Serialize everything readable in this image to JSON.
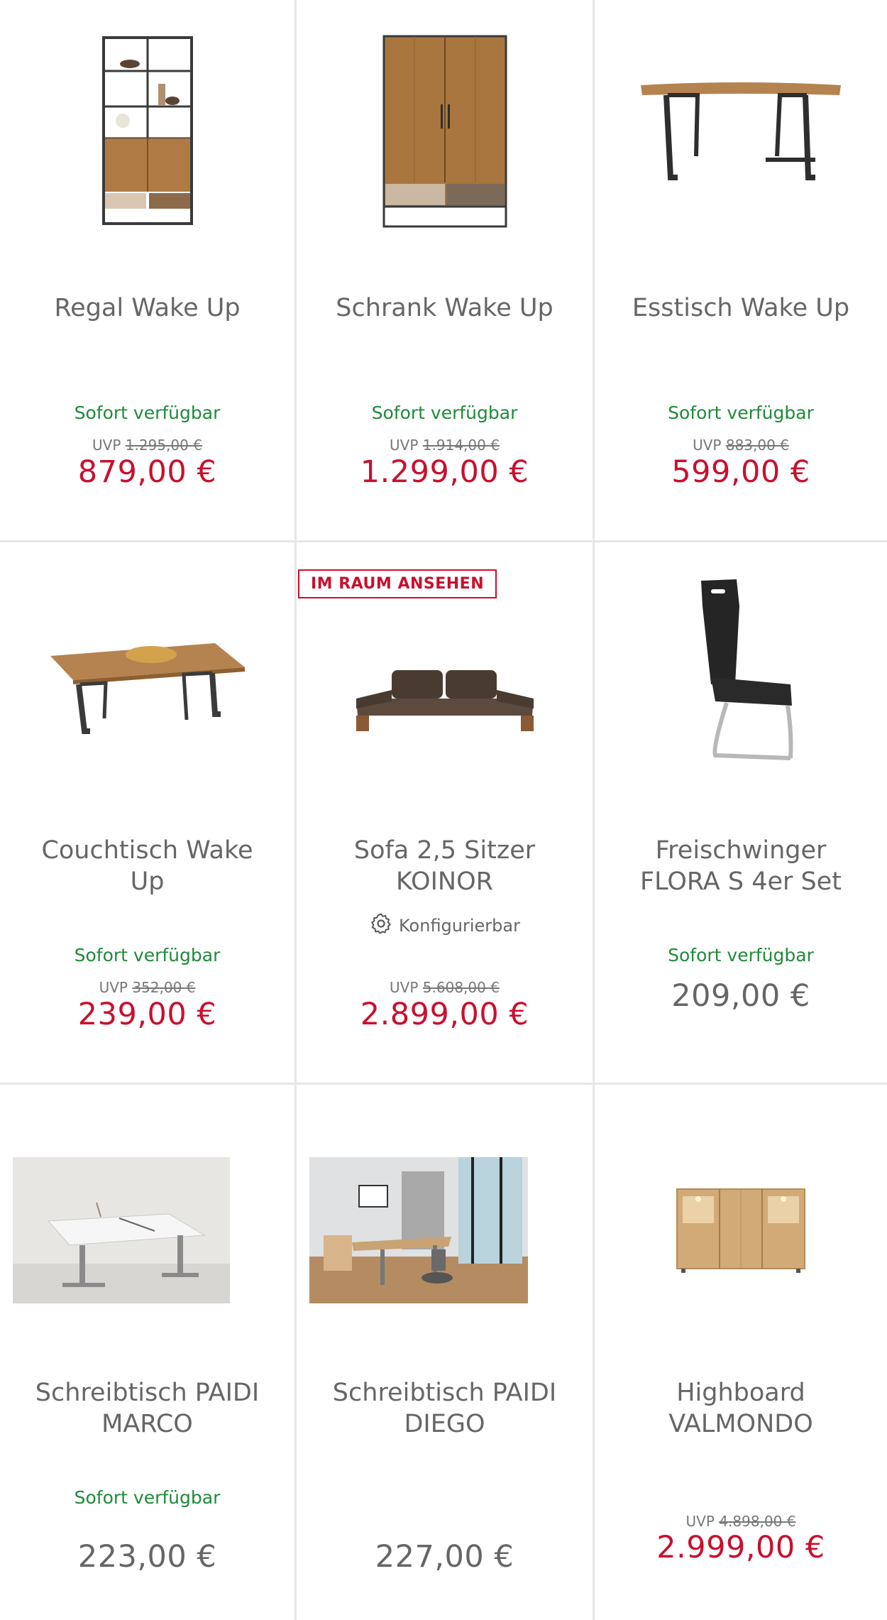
{
  "products": [
    {
      "title": "Regal Wake Up",
      "availability": "Sofort verfügbar",
      "uvp_label": "UVP",
      "uvp": "1.295,00 €",
      "price": "879,00 €",
      "image": "shelf-image"
    },
    {
      "title": "Schrank Wake Up",
      "availability": "Sofort verfügbar",
      "uvp_label": "UVP",
      "uvp": "1.914,00 €",
      "price": "1.299,00 €",
      "image": "wardrobe-image"
    },
    {
      "title": "Esstisch Wake Up",
      "availability": "Sofort verfügbar",
      "uvp_label": "UVP",
      "uvp": "883,00 €",
      "price": "599,00 €",
      "image": "dining-table-image"
    },
    {
      "title": "Couchtisch Wake Up",
      "availability": "Sofort verfügbar",
      "uvp_label": "UVP",
      "uvp": "352,00 €",
      "price": "239,00 €",
      "image": "coffee-table-image"
    },
    {
      "badge": "IM RAUM ANSEHEN",
      "title": "Sofa 2,5 Sitzer KOINOR",
      "configurable": "Konfigurierbar",
      "uvp_label": "UVP",
      "uvp": "5.608,00 €",
      "price": "2.899,00 €",
      "image": "sofa-image"
    },
    {
      "title": "Freischwinger FLORA S 4er Set",
      "availability": "Sofort verfügbar",
      "price": "209,00 €",
      "image": "chair-image"
    },
    {
      "title": "Schreibtisch PAIDI MARCO",
      "availability": "Sofort verfügbar",
      "price": "223,00 €",
      "image": "desk-room-image"
    },
    {
      "title": "Schreibtisch PAIDI DIEGO",
      "price": "227,00 €",
      "image": "office-room-image"
    },
    {
      "title": "Highboard VALMONDO",
      "uvp_label": "UVP",
      "uvp": "4.898,00 €",
      "price": "2.999,00 €",
      "image": "highboard-image"
    }
  ],
  "colors": {
    "sale": "#c8102e",
    "available": "#1e8a3a",
    "text": "#666666",
    "divider": "#e6e6e6"
  }
}
